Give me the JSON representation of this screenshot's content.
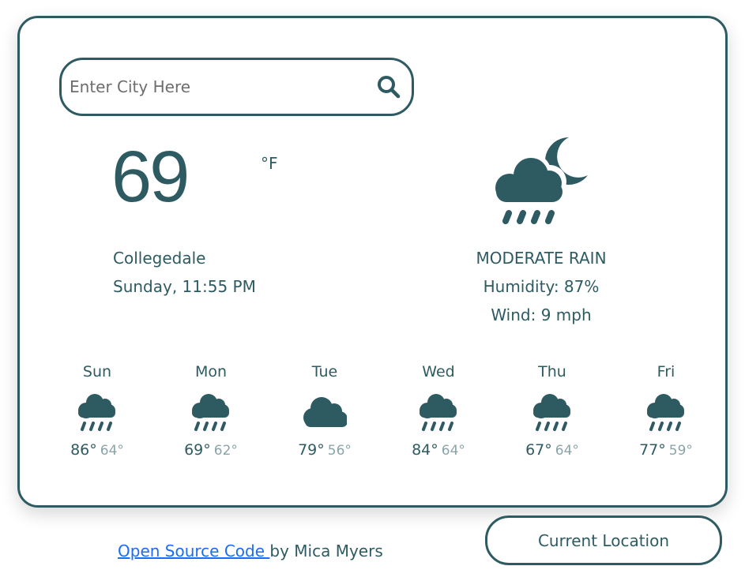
{
  "search": {
    "placeholder": "Enter City Here",
    "value": "",
    "icon": "search-icon"
  },
  "current": {
    "temperature": "69",
    "unit": "°F",
    "city": "Collegedale",
    "datetime": "Sunday, 11:55 PM",
    "icon": "night-rain-icon",
    "description": "MODERATE RAIN",
    "humidity": "Humidity: 87%",
    "wind": "Wind: 9 mph"
  },
  "forecast": [
    {
      "day": "Sun",
      "icon": "rain-icon",
      "high": "86°",
      "low": "64°"
    },
    {
      "day": "Mon",
      "icon": "rain-icon",
      "high": "69°",
      "low": "62°"
    },
    {
      "day": "Tue",
      "icon": "cloud-icon",
      "high": "79°",
      "low": "56°"
    },
    {
      "day": "Wed",
      "icon": "rain-icon",
      "high": "84°",
      "low": "64°"
    },
    {
      "day": "Thu",
      "icon": "rain-icon",
      "high": "67°",
      "low": "64°"
    },
    {
      "day": "Fri",
      "icon": "rain-icon",
      "high": "77°",
      "low": "59°"
    }
  ],
  "footer": {
    "link_label": "Open Source Code ",
    "byline": " by Mica Myers",
    "location_button": "Current Location"
  },
  "colors": {
    "primary": "#2e5b62",
    "muted": "#8aa4a8",
    "link": "#1a6ef5"
  }
}
